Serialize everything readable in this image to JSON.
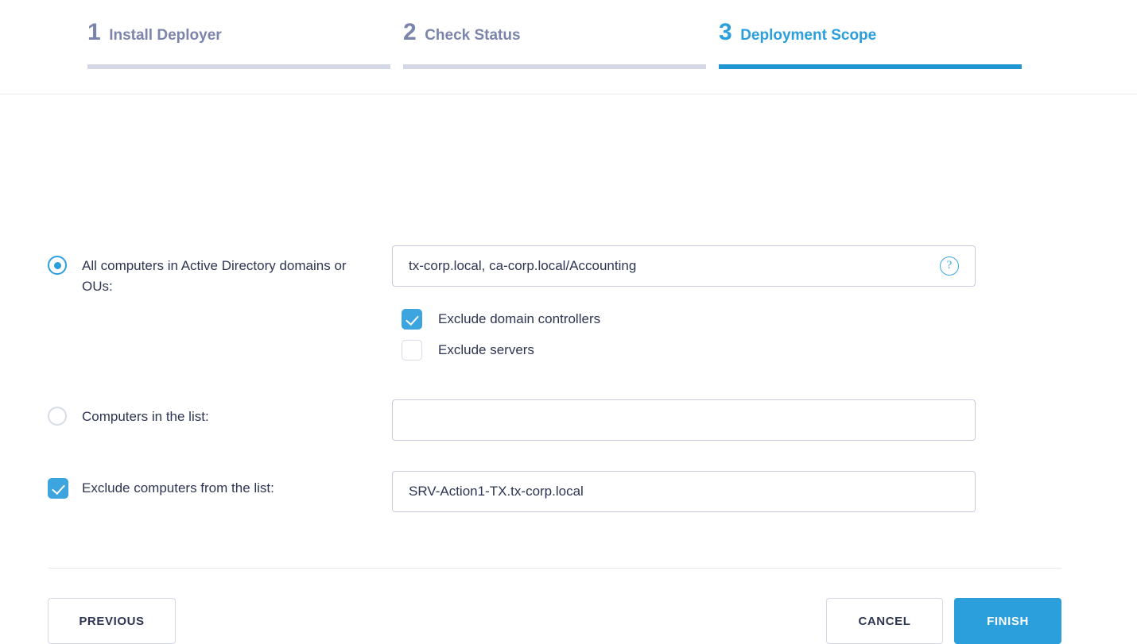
{
  "wizard": {
    "steps": [
      {
        "number": "1",
        "label": "Install Deployer",
        "active": false
      },
      {
        "number": "2",
        "label": "Check Status",
        "active": false
      },
      {
        "number": "3",
        "label": "Deployment Scope",
        "active": true
      }
    ]
  },
  "scope": {
    "ad_option": {
      "label": "All computers in Active Directory domains or OUs:",
      "selected": true,
      "input_value": "tx-corp.local, ca-corp.local/Accounting",
      "input_placeholder": "",
      "help_icon": "question-mark-icon",
      "help_label": "?"
    },
    "sub_options": [
      {
        "label": "Exclude domain controllers",
        "checked": true
      },
      {
        "label": "Exclude servers",
        "checked": false
      }
    ],
    "list_option": {
      "label": "Computers in the list:",
      "selected": false,
      "input_value": "",
      "input_placeholder": ""
    },
    "exclude_option": {
      "label": "Exclude computers from the list:",
      "checked": true,
      "input_value": "SRV-Action1-TX.tx-corp.local",
      "input_placeholder": ""
    }
  },
  "footer": {
    "previous_label": "PREVIOUS",
    "cancel_label": "CANCEL",
    "finish_label": "FINISH"
  },
  "colors": {
    "accent": "#2b9fdc",
    "accent_fill": "#3ca5e0",
    "inactive_step": "#7b85ab",
    "inactive_bar": "#d4d8e6",
    "text": "#2e3552",
    "border": "#c7cbdb"
  }
}
